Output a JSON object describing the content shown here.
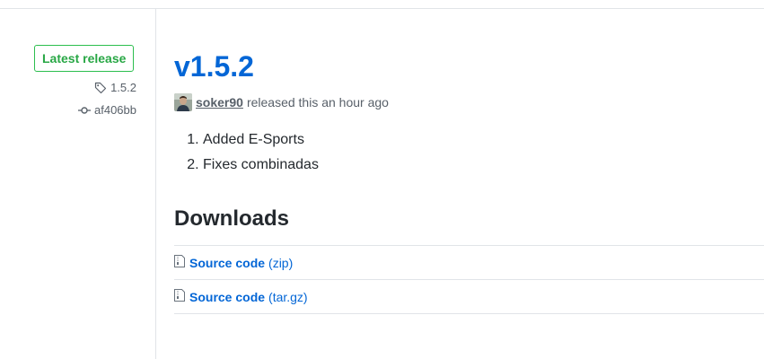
{
  "sidebar": {
    "badge": "Latest release",
    "tag": "1.5.2",
    "commit": "af406bb"
  },
  "release": {
    "title": "v1.5.2",
    "author": "soker90",
    "released_text": "released this an hour ago",
    "notes": [
      "Added E-Sports",
      "Fixes combinadas"
    ]
  },
  "downloads": {
    "title": "Downloads",
    "assets": [
      {
        "label": "Source code",
        "ext": "(zip)",
        "icon": "file-zip-icon"
      },
      {
        "label": "Source code",
        "ext": "(tar.gz)",
        "icon": "file-zip-icon"
      }
    ]
  },
  "colors": {
    "link": "#0366d6",
    "badge_green": "#28a745",
    "muted": "#586069",
    "border": "#e1e4e8"
  }
}
